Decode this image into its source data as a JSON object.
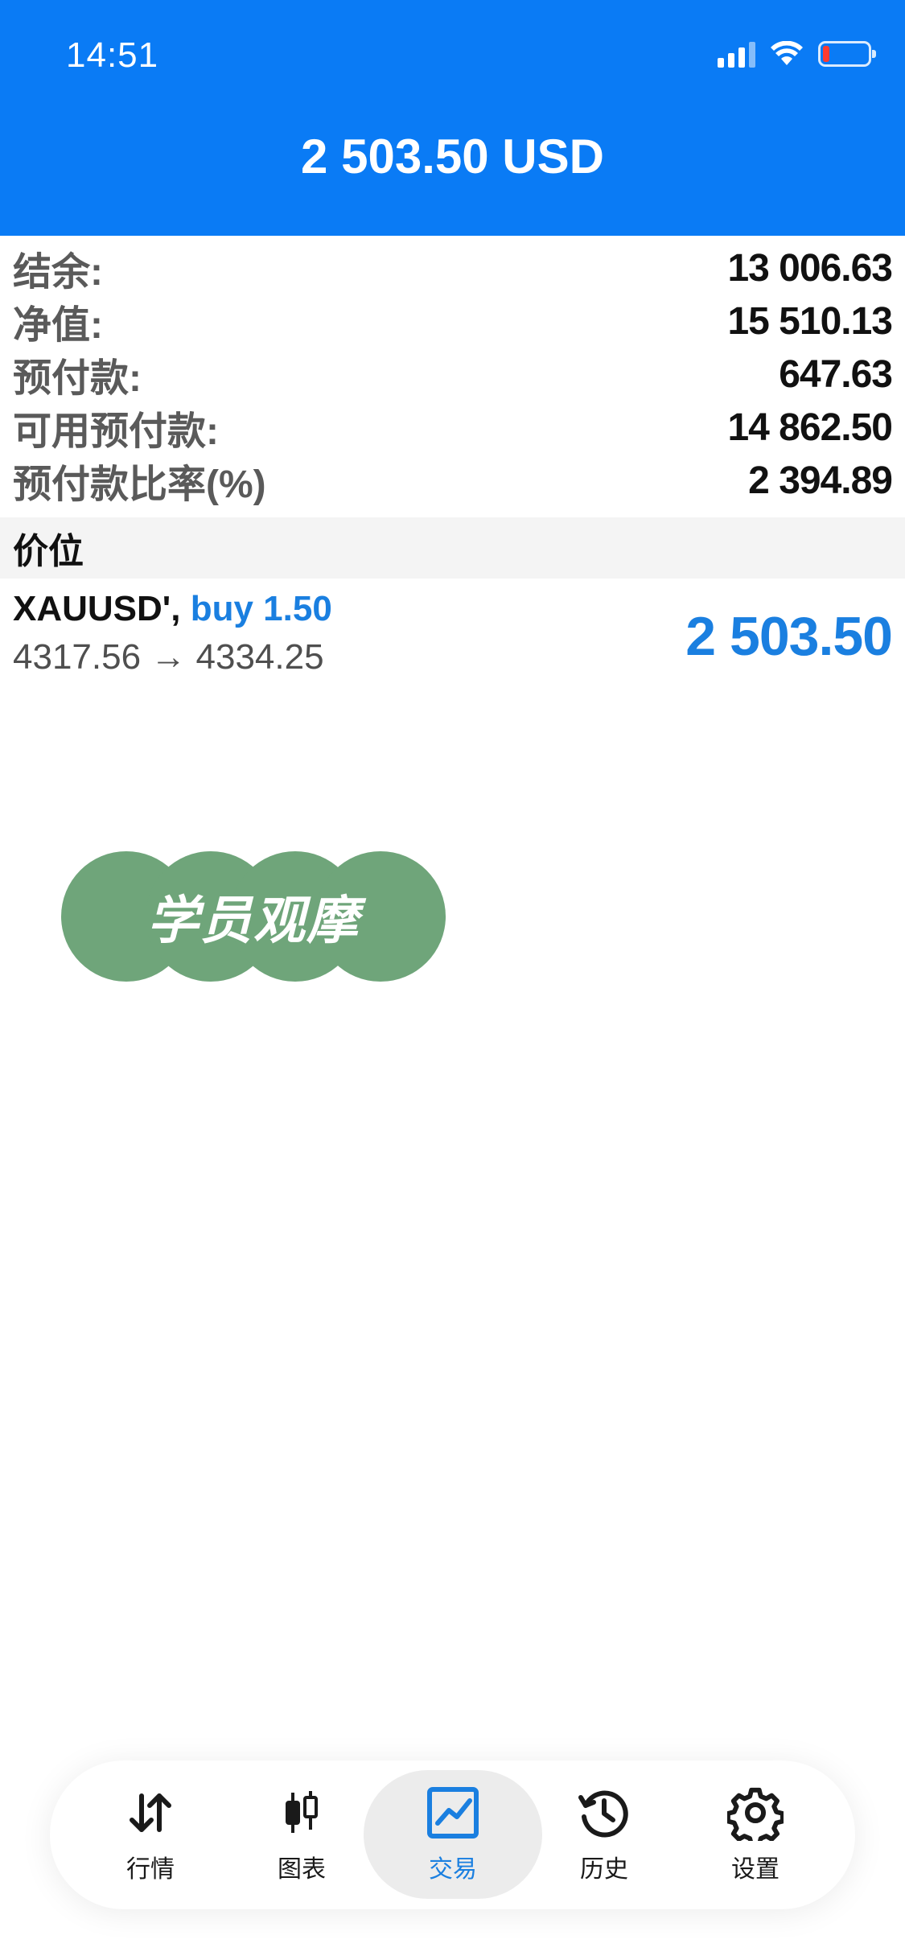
{
  "status_bar": {
    "time": "14:51"
  },
  "header": {
    "title": "2 503.50 USD"
  },
  "account": [
    {
      "label": "结余:",
      "value": "13 006.63"
    },
    {
      "label": "净值:",
      "value": "15 510.13"
    },
    {
      "label": "预付款:",
      "value": "647.63"
    },
    {
      "label": "可用预付款:",
      "value": "14 862.50"
    },
    {
      "label": "预付款比率(%)",
      "value": "2 394.89"
    }
  ],
  "section": {
    "title": "价位"
  },
  "position": {
    "symbol": "XAUUSD',",
    "type": "buy 1.50",
    "prices": "4317.56 → 4334.25",
    "profit": "2 503.50"
  },
  "watermark": {
    "text": "学员观摩"
  },
  "tabs": [
    {
      "label": "行情",
      "icon": "quotes-arrows-icon"
    },
    {
      "label": "图表",
      "icon": "candlestick-chart-icon"
    },
    {
      "label": "交易",
      "icon": "trade-chart-icon"
    },
    {
      "label": "历史",
      "icon": "history-clock-icon"
    },
    {
      "label": "设置",
      "icon": "settings-gear-icon"
    }
  ],
  "colors": {
    "header": "#0a7bf5",
    "accent": "#1a7fe0",
    "watermark": "#6fa57a"
  }
}
